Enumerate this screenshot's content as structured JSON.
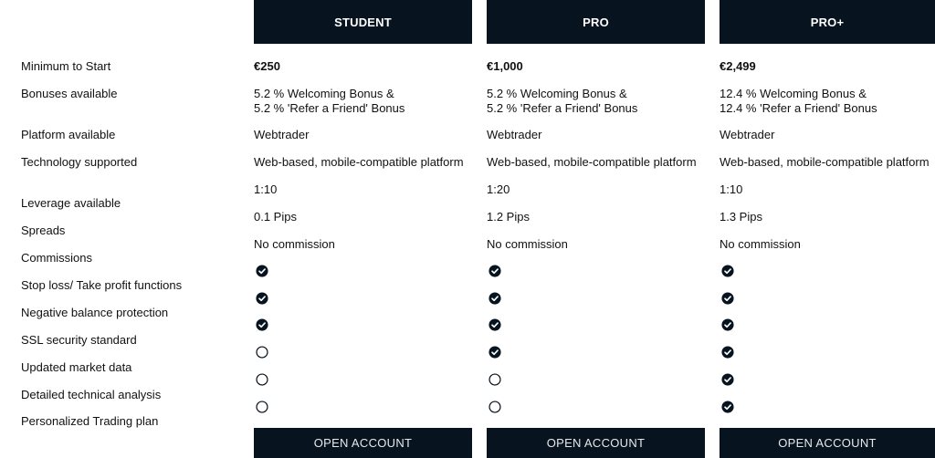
{
  "plans": [
    {
      "name": "STUDENT",
      "minimum": "€250",
      "bonus_line1": "5.2 % Welcoming Bonus &",
      "bonus_line2": "5.2 % 'Refer a Friend' Bonus",
      "platform": "Webtrader",
      "technology": "Web-based, mobile-compatible platform",
      "leverage": "1:10",
      "spreads": "0.1 Pips",
      "commissions": "No commission",
      "features": [
        true,
        true,
        true,
        false,
        false,
        false
      ],
      "button": "OPEN ACCOUNT"
    },
    {
      "name": "PRO",
      "minimum": "€1,000",
      "bonus_line1": "5.2 % Welcoming Bonus &",
      "bonus_line2": "5.2 % 'Refer a Friend' Bonus",
      "platform": "Webtrader",
      "technology": "Web-based, mobile-compatible platform",
      "leverage": "1:20",
      "spreads": "1.2 Pips",
      "commissions": "No commission",
      "features": [
        true,
        true,
        true,
        true,
        false,
        false
      ],
      "button": "OPEN ACCOUNT"
    },
    {
      "name": "PRO+",
      "minimum": "€2,499",
      "bonus_line1": "12.4 % Welcoming Bonus &",
      "bonus_line2": "12.4 % 'Refer a Friend' Bonus",
      "platform": "Webtrader",
      "technology": "Web-based, mobile-compatible platform",
      "leverage": "1:10",
      "spreads": "1.3 Pips",
      "commissions": "No commission",
      "features": [
        true,
        true,
        true,
        true,
        true,
        true
      ],
      "button": "OPEN ACCOUNT"
    }
  ],
  "row_labels": {
    "minimum": "Minimum to Start",
    "bonuses": "Bonuses available",
    "platform": "Platform available",
    "technology": "Technology supported",
    "leverage": "Leverage available",
    "spreads": "Spreads",
    "commissions": "Commissions",
    "features": [
      "Stop loss/ Take profit functions",
      "Negative balance protection",
      "SSL security standard",
      "Updated market data",
      "Detailed technical analysis",
      "Personalized Trading plan"
    ]
  },
  "icons": {
    "included": "check-circle-filled",
    "excluded": "circle-outline"
  },
  "colors": {
    "header_bg": "#07131f",
    "header_text": "#ffffff",
    "icon": "#07131f"
  }
}
